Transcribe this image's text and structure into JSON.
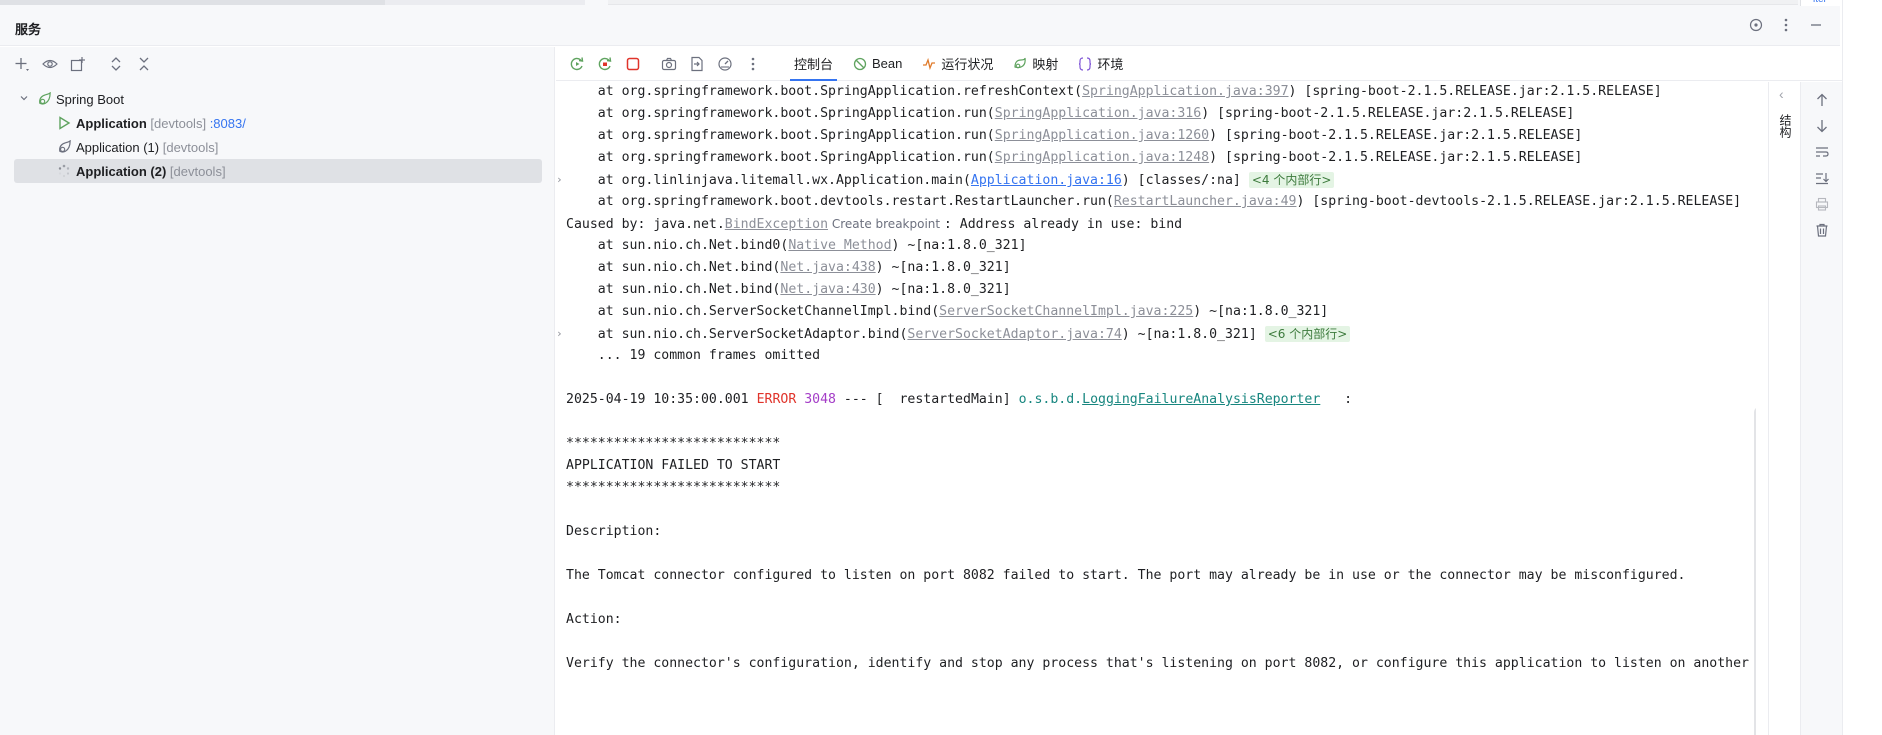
{
  "top_strip": {
    "right_text": "iter"
  },
  "panel": {
    "title": "服务"
  },
  "tree": {
    "root_label": "Spring Boot",
    "items": [
      {
        "name": "Application",
        "suffix": "[devtools]",
        "port": ":8083/"
      },
      {
        "name": "Application (1)",
        "suffix": "[devtools]"
      },
      {
        "name": "Application (2)",
        "suffix": "[devtools]"
      }
    ]
  },
  "console_tabs": [
    {
      "label": "控制台",
      "icon": "console"
    },
    {
      "label": "Bean",
      "icon": "bean-icon"
    },
    {
      "label": "运行状况",
      "icon": "health-icon"
    },
    {
      "label": "映射",
      "icon": "mapping-icon"
    },
    {
      "label": "环境",
      "icon": "env-icon"
    }
  ],
  "side_strip": {
    "vertical_text": "结构"
  },
  "console": {
    "l1_pre": "    at org.springframework.boot.SpringApplication.refreshContext(",
    "l1_link": "SpringApplication.java:397",
    "l1_post": ") [spring-boot-2.1.5.RELEASE.jar:2.1.5.RELEASE]",
    "l2_pre": "    at org.springframework.boot.SpringApplication.run(",
    "l2_link": "SpringApplication.java:316",
    "l2_post": ") [spring-boot-2.1.5.RELEASE.jar:2.1.5.RELEASE]",
    "l3_pre": "    at org.springframework.boot.SpringApplication.run(",
    "l3_link": "SpringApplication.java:1260",
    "l3_post": ") [spring-boot-2.1.5.RELEASE.jar:2.1.5.RELEASE]",
    "l4_pre": "    at org.springframework.boot.SpringApplication.run(",
    "l4_link": "SpringApplication.java:1248",
    "l4_post": ") [spring-boot-2.1.5.RELEASE.jar:2.1.5.RELEASE]",
    "l5_pre": "    at org.linlinjava.litemall.wx.Application.main(",
    "l5_link": "Application.java:16",
    "l5_post": ") [classes/:na] ",
    "l5_badge": "<4 个内部行>",
    "l6_pre": "    at org.springframework.boot.devtools.restart.RestartLauncher.run(",
    "l6_link": "RestartLauncher.java:49",
    "l6_post": ") [spring-boot-devtools-2.1.5.RELEASE.jar:2.1.5.RELEASE]",
    "l7_pre": "Caused by: java.net.",
    "l7_link": "BindException",
    "l7_hint": " Create breakpoint ",
    "l7_post": ": Address already in use: bind",
    "l8_pre": "    at sun.nio.ch.Net.bind0(",
    "l8_link": "Native Method",
    "l8_post": ") ~[na:1.8.0_321]",
    "l9_pre": "    at sun.nio.ch.Net.bind(",
    "l9_link": "Net.java:438",
    "l9_post": ") ~[na:1.8.0_321]",
    "l10_pre": "    at sun.nio.ch.Net.bind(",
    "l10_link": "Net.java:430",
    "l10_post": ") ~[na:1.8.0_321]",
    "l11_pre": "    at sun.nio.ch.ServerSocketChannelImpl.bind(",
    "l11_link": "ServerSocketChannelImpl.java:225",
    "l11_post": ") ~[na:1.8.0_321]",
    "l12_pre": "    at sun.nio.ch.ServerSocketAdaptor.bind(",
    "l12_link": "ServerSocketAdaptor.java:74",
    "l12_post": ") ~[na:1.8.0_321] ",
    "l12_badge": "<6 个内部行>",
    "l13": "    ... 19 common frames omitted",
    "log_time": "2025-04-19 10:35:00.001 ",
    "log_level": "ERROR",
    "log_pid": " 3048",
    "log_mid": " --- [  restartedMain] ",
    "log_pkg": "o.s.b.d.",
    "log_class": "LoggingFailureAnalysisReporter",
    "log_tail": "   :",
    "stars1": "***************************",
    "failed": "APPLICATION FAILED TO START",
    "stars2": "***************************",
    "desc_label": "Description:",
    "desc_text": "The Tomcat connector configured to listen on port 8082 failed to start. The port may already be in use or the connector may be misconfigured.",
    "action_label": "Action:",
    "action_text": "Verify the connector's configuration, identify and stop any process that's listening on port 8082, or configure this application to listen on another"
  }
}
